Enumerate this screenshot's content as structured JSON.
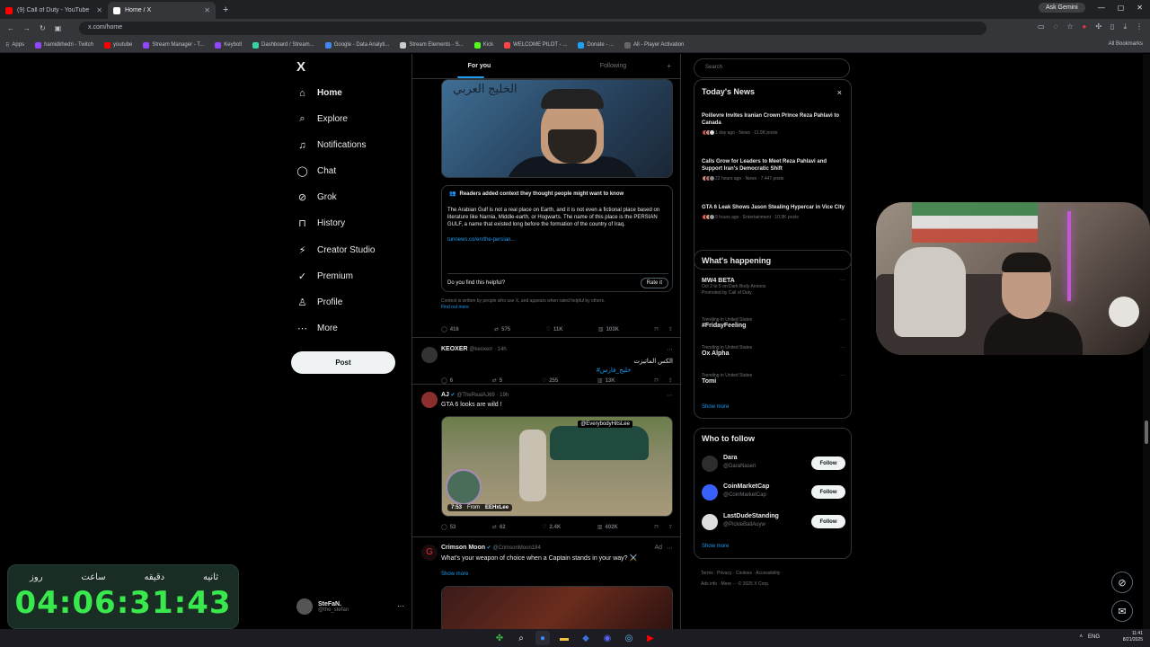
{
  "browser": {
    "tabs": [
      {
        "title": "(9) Call of Duty - YouTube",
        "color": "#ff0000",
        "active": false
      },
      {
        "title": "Home / X",
        "color": "#ffffff",
        "active": true
      }
    ],
    "new_tab": "+",
    "ask_gemini": "Ask Gemini",
    "url": "x.com/home",
    "bookmarks_label": "Apps",
    "bookmarks": [
      {
        "label": "hamidkhedri - Twitch",
        "color": "#9146ff"
      },
      {
        "label": "youtube",
        "color": "#ff0000"
      },
      {
        "label": "Stream Manager - T...",
        "color": "#9146ff"
      },
      {
        "label": "Keyboll",
        "color": "#9146ff"
      },
      {
        "label": "Dashboard / Stream...",
        "color": "#3bd1a6"
      },
      {
        "label": "Google - Data Analyti...",
        "color": "#4285f4"
      },
      {
        "label": "Stream Elements - S...",
        "color": "#cccccc"
      },
      {
        "label": "Kick",
        "color": "#53fc18"
      },
      {
        "label": "WELCOME PILOT - ...",
        "color": "#ff4444"
      },
      {
        "label": "Donate - ...",
        "color": "#1da1f2"
      },
      {
        "label": "All - Player Activation",
        "color": "#666666"
      }
    ],
    "all_bookmarks": "All Bookmarks"
  },
  "nav": {
    "logo": "X",
    "items": [
      {
        "label": "Home",
        "icon": "home-icon",
        "glyph": "⌂"
      },
      {
        "label": "Explore",
        "icon": "search-icon",
        "glyph": "⌕"
      },
      {
        "label": "Notifications",
        "icon": "bell-icon",
        "glyph": "♫"
      },
      {
        "label": "Chat",
        "icon": "chat-icon",
        "glyph": "◯"
      },
      {
        "label": "Grok",
        "icon": "grok-icon",
        "glyph": "⊘"
      },
      {
        "label": "History",
        "icon": "bookmark-icon",
        "glyph": "⊓"
      },
      {
        "label": "Creator Studio",
        "icon": "lightning-icon",
        "glyph": "⚡"
      },
      {
        "label": "Premium",
        "icon": "verified-icon",
        "glyph": "✓"
      },
      {
        "label": "Profile",
        "icon": "person-icon",
        "glyph": "♙"
      },
      {
        "label": "More",
        "icon": "more-icon",
        "glyph": "⋯"
      }
    ],
    "post_button": "Post",
    "account": {
      "name": "SteFaN.",
      "handle": "@the_stefan",
      "more": "···"
    }
  },
  "feed": {
    "tabs": [
      "For you",
      "Following"
    ],
    "settings": "+",
    "post1": {
      "image_text": "الخليج العربي",
      "note_header": "Readers added context they thought people might want to know",
      "note_body": "The Arabian Gulf is not a real place on Earth, and it is not even a fictional place based on literature like Narnia, Middle-earth, or Hogwarts. The name of this place is the PERSIAN GULF, a name that existed long before the formation of the country of Iraq.",
      "note_link": "tunnews.co/en/the-persian...",
      "helpful_question": "Do you find this helpful?",
      "rate_button": "Rate it",
      "fine_print": "Context is written by people who use X, and appears when rated helpful by others.",
      "find_out_more": "Find out more",
      "actions": {
        "replies": "416",
        "reposts": "575",
        "likes": "11K",
        "views": "103K"
      }
    },
    "post2": {
      "name": "KEOXER",
      "meta": "@keoxerr · 14h",
      "text": "الکس الماتیزت",
      "hashtag": "#خلیج_فارس",
      "actions": {
        "replies": "6",
        "reposts": "5",
        "likes": "255",
        "views": "13K"
      }
    },
    "post3": {
      "name": "AJ",
      "meta": "@TheRealAJ69 · 19h",
      "text": "GTA 6 looks are wild !",
      "video_tag": "@EverybodyHitsLee",
      "duration": "7:53",
      "from_label": "From",
      "from_source": "EEHxLee",
      "actions": {
        "replies": "53",
        "reposts": "62",
        "likes": "2.4K",
        "views": "402K"
      }
    },
    "post4": {
      "name": "Crimson Moon",
      "meta": "@CrimsonMoon184",
      "ad": "Ad",
      "text": "What's your weapon of choice when a Captain stands in your way? ⚔️",
      "show_more": "Show more"
    }
  },
  "sidebar": {
    "search_placeholder": "Search",
    "news_title": "Today's News",
    "news_close": "×",
    "news": [
      {
        "headline": "Poilievre Invites Iranian Crown Prince Reza Pahlavi to Canada",
        "meta": "1 day ago · News · 11.9K posts"
      },
      {
        "headline": "Calls Grow for Leaders to Meet Reza Pahlavi and Support Iran's Democratic Shift",
        "meta": "22 hours ago · News · 7,447 posts"
      },
      {
        "headline": "GTA 6 Leak Shows Jason Stealing Hypercar in Vice City",
        "meta": "9 hours ago · Entertainment · 10.9K posts"
      }
    ],
    "happening_title": "What's happening",
    "trends": [
      {
        "category": "",
        "name": "MW4 BETA",
        "sub": "Oct 2 to 5 on Dark Body Annoos",
        "sub2": "Promoted by Call of Duty"
      },
      {
        "category": "Trending in United States",
        "name": "#FridayFeeling",
        "sub": "",
        "sub2": ""
      },
      {
        "category": "Trending in United States",
        "name": "Ox Alpha",
        "sub": "",
        "sub2": ""
      },
      {
        "category": "Trending in United States",
        "name": "Tomi",
        "sub": "",
        "sub2": ""
      }
    ],
    "trend_more": "···",
    "show_more": "Show more",
    "who_title": "Who to follow",
    "who": [
      {
        "name": "Dara",
        "handle": "@DaraNaseri",
        "button": "Follow",
        "color": "#2d2d2d"
      },
      {
        "name": "CoinMarketCap",
        "handle": "@CoinMarketCap",
        "button": "Follow",
        "color": "#3861fb"
      },
      {
        "name": "LastDudeStanding",
        "handle": "@PickleBallAuyw",
        "button": "Follow",
        "color": "#dddddd"
      }
    ],
    "who_more": "Show more",
    "footer_line1": "Terms · Privacy · Cookies · Accessibility ·",
    "footer_line2": "Ads info · More ··· © 2025 X Corp."
  },
  "timer": {
    "labels": [
      "ثانیه",
      "دقیقه",
      "ساعت",
      "روز"
    ],
    "value": "04:06:31:43"
  },
  "fabs": [
    {
      "icon": "grok-icon",
      "glyph": "⊘"
    },
    {
      "icon": "message-icon",
      "glyph": "✉"
    }
  ],
  "taskbar": {
    "apps": [
      {
        "icon": "start-icon",
        "glyph": "✤",
        "color": "#3cb043"
      },
      {
        "icon": "search-icon",
        "glyph": "⌕",
        "color": "#ffffff"
      },
      {
        "icon": "chrome-icon",
        "glyph": "●",
        "color": "#4285f4"
      },
      {
        "icon": "folder-icon",
        "glyph": "▬",
        "color": "#f5c242"
      },
      {
        "icon": "msi-icon",
        "glyph": "◆",
        "color": "#3c6fd8"
      },
      {
        "icon": "discord-icon",
        "glyph": "◉",
        "color": "#5865f2"
      },
      {
        "icon": "steam-icon",
        "glyph": "◎",
        "color": "#1b2838"
      },
      {
        "icon": "youtube-icon",
        "glyph": "▶",
        "color": "#ff0000"
      }
    ],
    "tray_lang": "ENG",
    "time": "11:41",
    "date": "8/21/2025"
  }
}
